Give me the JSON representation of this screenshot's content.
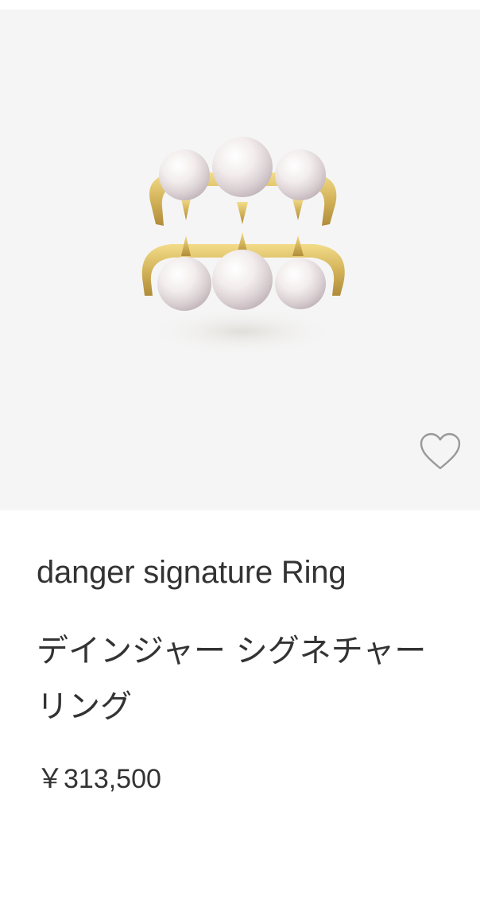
{
  "product": {
    "name_en": "danger signature Ring",
    "name_ja": "デインジャー シグネチャー リング",
    "price": "￥313,500",
    "favorite_icon": "heart-outline-icon",
    "image_alt": "pearl-ring-image"
  },
  "colors": {
    "image_background": "#f5f5f5",
    "text": "#333333",
    "icon_stroke": "#999999",
    "gold": "#d9b95a",
    "pearl": "#f2ecec"
  }
}
